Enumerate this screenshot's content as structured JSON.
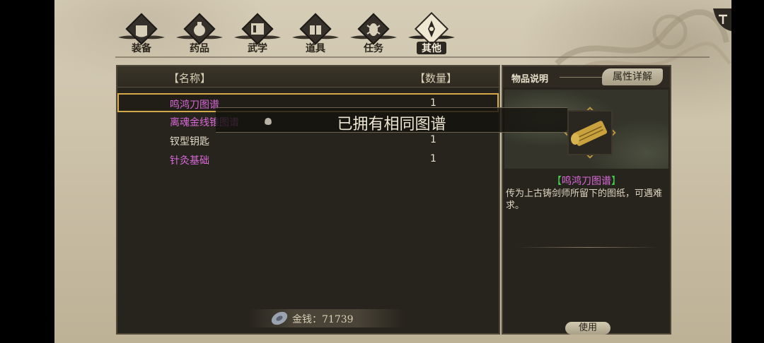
{
  "tabs": [
    {
      "label": "装备",
      "icon": "armor-icon"
    },
    {
      "label": "药品",
      "icon": "medicine-icon"
    },
    {
      "label": "武学",
      "icon": "scroll-book-icon"
    },
    {
      "label": "道具",
      "icon": "gift-box-icon"
    },
    {
      "label": "任务",
      "icon": "quest-bug-icon"
    },
    {
      "label": "其他",
      "icon": "misc-emblem-icon"
    }
  ],
  "active_tab": "其他",
  "list": {
    "header_name": "【名称】",
    "header_qty": "【数量】",
    "items": [
      {
        "name": "鸣鸿刀图谱",
        "qty": "1",
        "color": "#d868d8",
        "selected": true
      },
      {
        "name": "离魂金线锥图谱",
        "qty": "1",
        "color": "#d868d8",
        "selected": false
      },
      {
        "name": "钗型钥匙",
        "qty": "1",
        "color": "#e2dbc7",
        "selected": false
      },
      {
        "name": "针灸基础",
        "qty": "1",
        "color": "#d868d8",
        "selected": false
      }
    ]
  },
  "money": {
    "label": "金钱：71739"
  },
  "detail": {
    "title": "物品说明",
    "attr_button": "属性详解",
    "item_name": "鸣鸿刀图谱",
    "bracket_open": "【",
    "bracket_close": "】",
    "description": "传为上古铸剑师所留下的图纸，可遇难求。",
    "use_button": "使用"
  },
  "toast": {
    "message": "已拥有相同图谱"
  },
  "colors": {
    "accent_gold": "#d4a94a",
    "rare_magenta": "#d868d8",
    "bracket_green": "#3ed34a"
  }
}
